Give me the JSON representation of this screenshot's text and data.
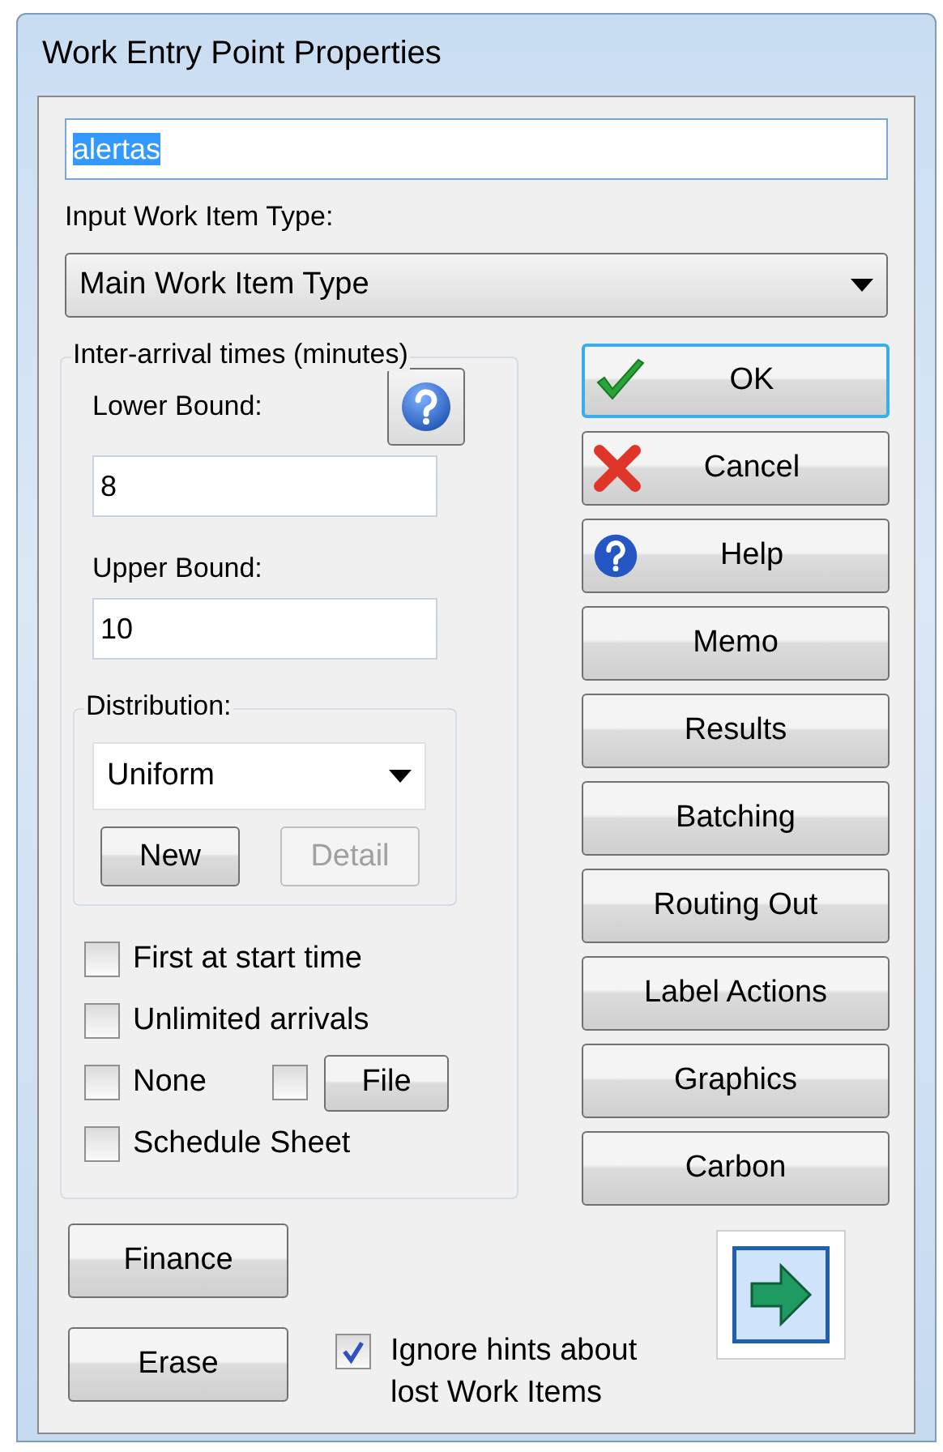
{
  "window": {
    "title": "Work Entry Point Properties"
  },
  "name_field": {
    "value": "alertas",
    "selected": true
  },
  "input_type": {
    "label": "Input Work Item Type:",
    "value": "Main Work Item Type"
  },
  "inter_arrival": {
    "legend": "Inter-arrival times (minutes)",
    "lower": {
      "label": "Lower Bound:",
      "value": "8"
    },
    "upper": {
      "label": "Upper Bound:",
      "value": "10"
    },
    "distribution": {
      "legend": "Distribution:",
      "value": "Uniform",
      "buttons": [
        {
          "label": "New",
          "disabled": false
        },
        {
          "label": "Detail",
          "disabled": true
        }
      ]
    },
    "options": [
      {
        "kind": "check",
        "label": "First at start time",
        "checked": false
      },
      {
        "kind": "check",
        "label": "Unlimited arrivals",
        "checked": false
      },
      {
        "kind": "check_file",
        "label": "None",
        "checked": false,
        "file_checked": false,
        "button": "File"
      },
      {
        "kind": "check",
        "label": "Schedule Sheet",
        "checked": false
      }
    ]
  },
  "side_buttons": [
    {
      "kind": "confirm",
      "label": "OK",
      "default": true
    },
    {
      "kind": "cancel",
      "label": "Cancel",
      "default": false
    },
    {
      "kind": "help",
      "label": "Help",
      "default": false
    },
    {
      "kind": "plain",
      "label": "Memo",
      "default": false
    },
    {
      "kind": "plain",
      "label": "Results",
      "default": false
    },
    {
      "kind": "plain",
      "label": "Batching",
      "default": false
    },
    {
      "kind": "plain",
      "label": "Routing Out",
      "default": false
    },
    {
      "kind": "plain",
      "label": "Label Actions",
      "default": false
    },
    {
      "kind": "plain",
      "label": "Graphics",
      "default": false
    },
    {
      "kind": "plain",
      "label": "Carbon",
      "default": false
    }
  ],
  "bottom_buttons": [
    "Finance",
    "Erase"
  ],
  "ignore_hints": {
    "label": "Ignore hints about lost Work Items",
    "checked": true
  }
}
